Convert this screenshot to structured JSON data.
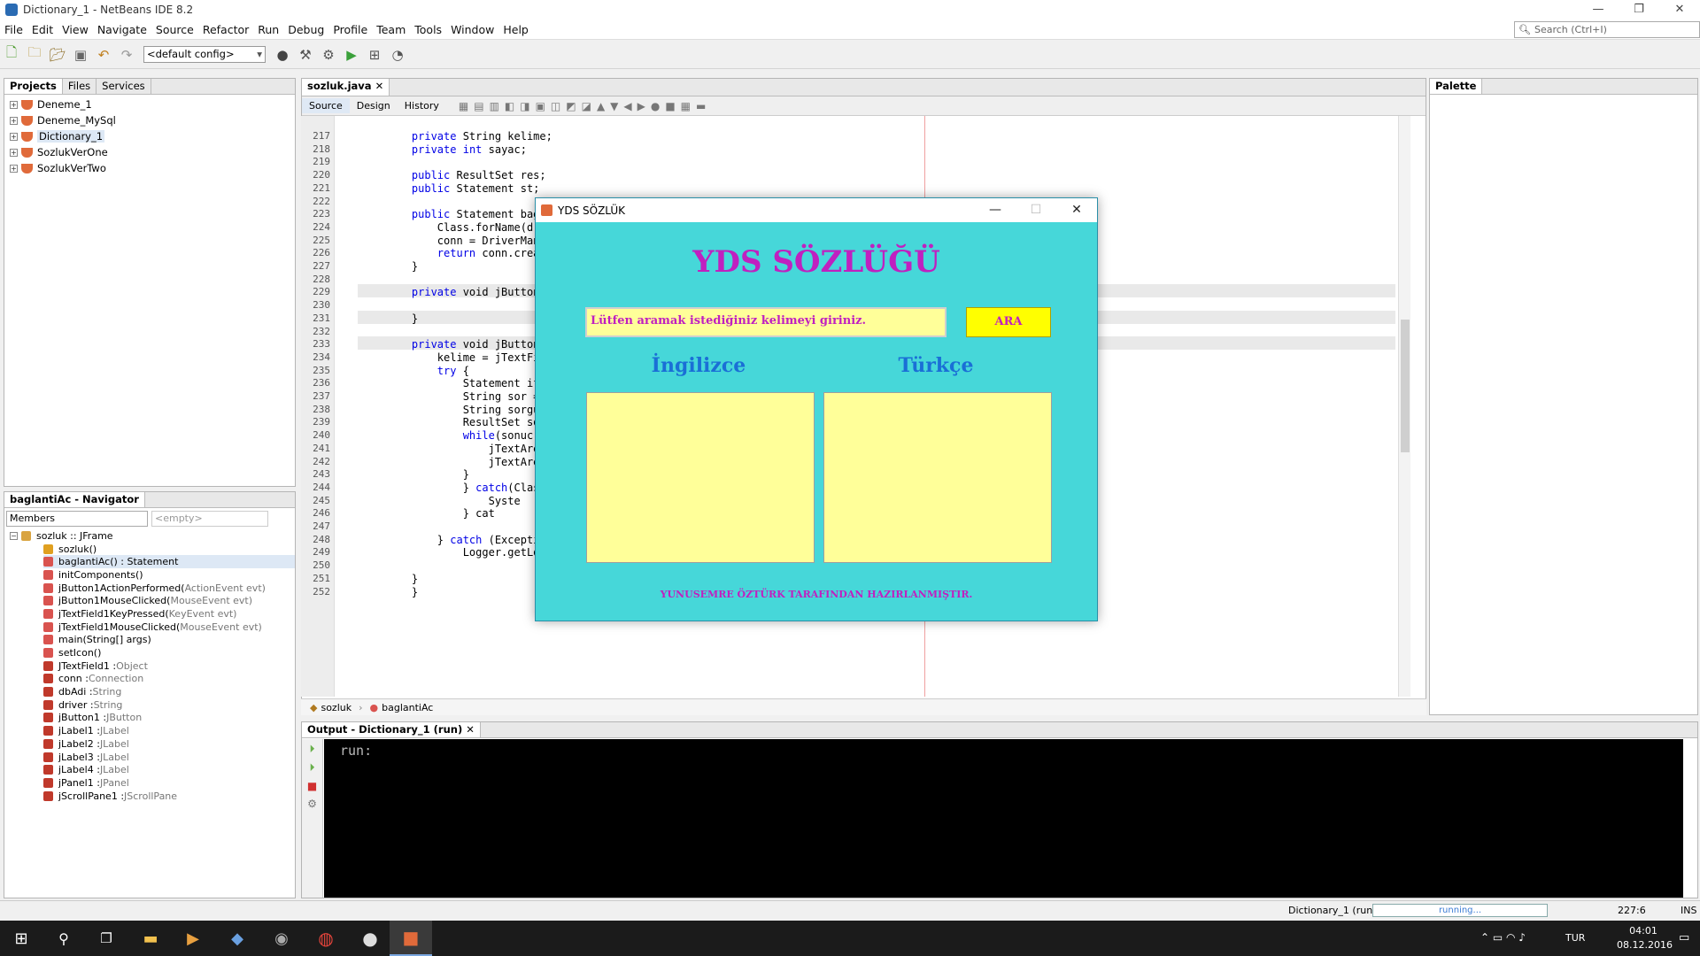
{
  "window": {
    "title": "Dictionary_1 - NetBeans IDE 8.2",
    "minimize": "—",
    "restore": "❐",
    "close": "✕"
  },
  "menu": [
    "File",
    "Edit",
    "View",
    "Navigate",
    "Source",
    "Refactor",
    "Run",
    "Debug",
    "Profile",
    "Team",
    "Tools",
    "Window",
    "Help"
  ],
  "search": {
    "placeholder": "Search (Ctrl+I)"
  },
  "toolbar": {
    "config": "<default config>"
  },
  "projects_panel": {
    "tabs": [
      "Projects",
      "Files",
      "Services"
    ],
    "items": [
      "Deneme_1",
      "Deneme_MySql",
      "Dictionary_1",
      "SozlukVerOne",
      "SozlukVerTwo"
    ]
  },
  "navigator": {
    "tab": "baglantiAc - Navigator",
    "filter": "Members",
    "filter_empty": "<empty>",
    "root": "sozluk :: JFrame",
    "items": [
      {
        "name": "sozluk()",
        "type": "",
        "color": "#e0a020"
      },
      {
        "name": "baglantiAc() : Statement",
        "type": "",
        "color": "#d9534f"
      },
      {
        "name": "initComponents()",
        "type": "",
        "color": "#d9534f"
      },
      {
        "name": "jButton1ActionPerformed(",
        "type": "ActionEvent evt)",
        "color": "#d9534f"
      },
      {
        "name": "jButton1MouseClicked(",
        "type": "MouseEvent evt)",
        "color": "#d9534f"
      },
      {
        "name": "jTextField1KeyPressed(",
        "type": "KeyEvent evt)",
        "color": "#d9534f"
      },
      {
        "name": "jTextField1MouseClicked(",
        "type": "MouseEvent evt)",
        "color": "#d9534f"
      },
      {
        "name": "main(String[] args)",
        "type": "",
        "color": "#d9534f"
      },
      {
        "name": "setIcon()",
        "type": "",
        "color": "#d9534f"
      },
      {
        "name": "JTextField1 : ",
        "type": "Object",
        "color": "#c0392b"
      },
      {
        "name": "conn : ",
        "type": "Connection",
        "color": "#c0392b"
      },
      {
        "name": "dbAdi : ",
        "type": "String",
        "color": "#c0392b"
      },
      {
        "name": "driver : ",
        "type": "String",
        "color": "#c0392b"
      },
      {
        "name": "jButton1 : ",
        "type": "JButton",
        "color": "#c0392b"
      },
      {
        "name": "jLabel1 : ",
        "type": "JLabel",
        "color": "#c0392b"
      },
      {
        "name": "jLabel2 : ",
        "type": "JLabel",
        "color": "#c0392b"
      },
      {
        "name": "jLabel3 : ",
        "type": "JLabel",
        "color": "#c0392b"
      },
      {
        "name": "jLabel4 : ",
        "type": "JLabel",
        "color": "#c0392b"
      },
      {
        "name": "jPanel1 : ",
        "type": "JPanel",
        "color": "#c0392b"
      },
      {
        "name": "jScrollPane1 : ",
        "type": "JScrollPane",
        "color": "#c0392b"
      }
    ]
  },
  "editor": {
    "file_tab": "sozluk.java",
    "subtabs": [
      "Source",
      "Design",
      "History"
    ],
    "lines": [
      {
        "n": "217",
        "code": "    private String kelime;"
      },
      {
        "n": "218",
        "code": "    private int sayac;"
      },
      {
        "n": "219",
        "code": ""
      },
      {
        "n": "220",
        "code": "    public ResultSet res;"
      },
      {
        "n": "221",
        "code": "    public Statement st;"
      },
      {
        "n": "222",
        "code": ""
      },
      {
        "n": "223",
        "code": "    public Statement bagl"
      },
      {
        "n": "224",
        "code": "        Class.forName(dri"
      },
      {
        "n": "225",
        "code": "        conn = DriverMana"
      },
      {
        "n": "226",
        "code": "        return conn.creat"
      },
      {
        "n": "227",
        "code": "    }"
      },
      {
        "n": "228",
        "code": ""
      },
      {
        "n": "229",
        "code": "    private void jButton1"
      },
      {
        "n": "230",
        "code": ""
      },
      {
        "n": "231",
        "code": "    }"
      },
      {
        "n": "232",
        "code": ""
      },
      {
        "n": "233",
        "code": "    private void jButton1"
      },
      {
        "n": "234",
        "code": "        kelime = jTextFie"
      },
      {
        "n": "235",
        "code": "        try {"
      },
      {
        "n": "236",
        "code": "            Statement ifa"
      },
      {
        "n": "237",
        "code": "            String sor ="
      },
      {
        "n": "238",
        "code": "            String sorgu"
      },
      {
        "n": "239",
        "code": "            ResultSet son"
      },
      {
        "n": "240",
        "code": "            while(sonuc.n"
      },
      {
        "n": "241",
        "code": "                jTextArea"
      },
      {
        "n": "242",
        "code": "                jTextArea"
      },
      {
        "n": "243",
        "code": "            }"
      },
      {
        "n": "244",
        "code": "            } catch(Class"
      },
      {
        "n": "245",
        "code": "                Syste"
      },
      {
        "n": "246",
        "code": "            } cat"
      },
      {
        "n": "247",
        "code": ""
      },
      {
        "n": "248",
        "code": "        } catch (Exception ex) {"
      },
      {
        "n": "249",
        "code": "            Logger.getLogger(sozluk.class.getName()).log(Level.SEVERE, null, ex);"
      },
      {
        "n": "250",
        "code": ""
      },
      {
        "n": "251",
        "code": "    }"
      },
      {
        "n": "252",
        "code": "    }"
      }
    ],
    "breadcrumbs": [
      "sozluk",
      "baglantiAc"
    ]
  },
  "palette": {
    "tab": "Palette"
  },
  "dialog": {
    "title": "YDS SÖZLÜK",
    "heading": "YDS SÖZLÜĞÜ",
    "input_value": "Lütfen aramak istediğiniz kelimeyi giriniz.",
    "button": "ARA",
    "label_en": "İngilizce",
    "label_tr": "Türkçe",
    "footer": "YUNUSEMRE ÖZTÜRK TARAFINDAN HAZIRLANMIŞTIR."
  },
  "output": {
    "tab": "Output - Dictionary_1 (run)",
    "text": "run:"
  },
  "status": {
    "project": "Dictionary_1 (run)",
    "progress": "running...",
    "position": "227:6",
    "mode": "INS"
  },
  "taskbar": {
    "lang": "TUR",
    "time": "04:01",
    "date": "08.12.2016"
  },
  "colors": {
    "dialog_bg": "#46d7d9",
    "field_bg": "#ffff99",
    "button_bg": "#ffff00",
    "heading": "#c020c0",
    "label": "#1a6fd6"
  }
}
